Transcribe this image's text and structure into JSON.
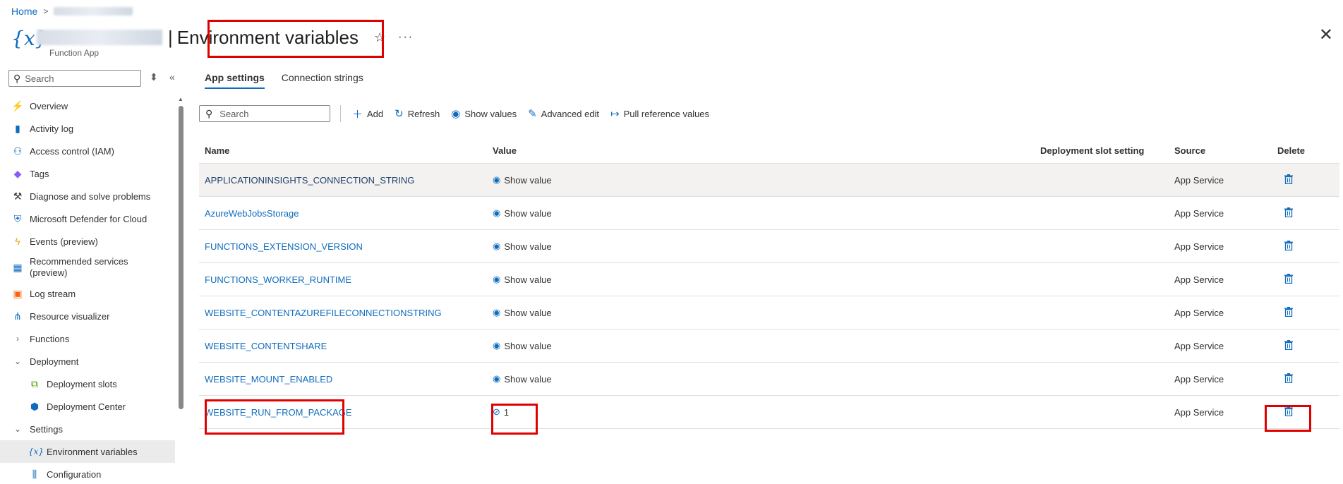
{
  "breadcrumb": {
    "home": "Home",
    "separator": ">"
  },
  "header": {
    "title": "Environment variables",
    "pipe": "|",
    "subtitle": "Function App",
    "resource_icon": "function-variable-icon",
    "favorite_icon": "star-icon",
    "more_label": "···",
    "close_label": "✕"
  },
  "sidebar": {
    "search_placeholder": "Search",
    "items": [
      {
        "label": "Overview",
        "icon": "lightning-overview-icon",
        "glyph": "⚡",
        "color": "#8a5cf6"
      },
      {
        "label": "Activity log",
        "icon": "book-icon",
        "glyph": "▮",
        "color": "#0f6cbd"
      },
      {
        "label": "Access control (IAM)",
        "icon": "people-icon",
        "glyph": "⚇",
        "color": "#0f6cbd"
      },
      {
        "label": "Tags",
        "icon": "tag-icon",
        "glyph": "◆",
        "color": "#8a5cf6"
      },
      {
        "label": "Diagnose and solve problems",
        "icon": "wrench-icon",
        "glyph": "⚒",
        "color": "#323130"
      },
      {
        "label": "Microsoft Defender for Cloud",
        "icon": "shield-icon",
        "glyph": "⛨",
        "color": "#0f6cbd"
      },
      {
        "label": "Events (preview)",
        "icon": "bolt-icon",
        "glyph": "ϟ",
        "color": "#e8a317"
      },
      {
        "label": "Recommended services (preview)",
        "icon": "grid-icon",
        "glyph": "▦",
        "color": "#0f6cbd"
      },
      {
        "label": "Log stream",
        "icon": "log-stream-icon",
        "glyph": "▣",
        "color": "#f7630c"
      },
      {
        "label": "Resource visualizer",
        "icon": "hierarchy-icon",
        "glyph": "⋔",
        "color": "#0f6cbd"
      },
      {
        "label": "Functions",
        "icon": "chevron-right-icon",
        "glyph": "›",
        "color": "#605e5c"
      },
      {
        "label": "Deployment",
        "icon": "chevron-down-icon",
        "glyph": "⌄",
        "color": "#605e5c"
      },
      {
        "label": "Deployment slots",
        "icon": "slots-icon",
        "glyph": "⧉",
        "color": "#57a300"
      },
      {
        "label": "Deployment Center",
        "icon": "cube-icon",
        "glyph": "⬢",
        "color": "#0f6cbd"
      },
      {
        "label": "Settings",
        "icon": "chevron-down-icon",
        "glyph": "⌄",
        "color": "#605e5c"
      },
      {
        "label": "Environment variables",
        "icon": "variable-icon",
        "glyph": "{x}",
        "color": "#0f6cbd"
      },
      {
        "label": "Configuration",
        "icon": "sliders-icon",
        "glyph": "⫼",
        "color": "#0f6cbd"
      }
    ]
  },
  "tabs": [
    {
      "label": "App settings",
      "active": true
    },
    {
      "label": "Connection strings",
      "active": false
    }
  ],
  "toolbar": {
    "search_placeholder": "Search",
    "add": "Add",
    "refresh": "Refresh",
    "show_values": "Show values",
    "advanced_edit": "Advanced edit",
    "pull_reference": "Pull reference values"
  },
  "table": {
    "columns": {
      "name": "Name",
      "value": "Value",
      "slot": "Deployment slot setting",
      "source": "Source",
      "delete": "Delete"
    },
    "rows": [
      {
        "name": "APPLICATIONINSIGHTS_CONNECTION_STRING",
        "value": "Show value",
        "source": "App Service"
      },
      {
        "name": "AzureWebJobsStorage",
        "value": "Show value",
        "source": "App Service"
      },
      {
        "name": "FUNCTIONS_EXTENSION_VERSION",
        "value": "Show value",
        "source": "App Service"
      },
      {
        "name": "FUNCTIONS_WORKER_RUNTIME",
        "value": "Show value",
        "source": "App Service"
      },
      {
        "name": "WEBSITE_CONTENTAZUREFILECONNECTIONSTRING",
        "value": "Show value",
        "source": "App Service"
      },
      {
        "name": "WEBSITE_CONTENTSHARE",
        "value": "Show value",
        "source": "App Service"
      },
      {
        "name": "WEBSITE_MOUNT_ENABLED",
        "value": "Show value",
        "source": "App Service"
      },
      {
        "name": "WEBSITE_RUN_FROM_PACKAGE",
        "value": "1",
        "source": "App Service"
      }
    ]
  },
  "colors": {
    "accent": "#0f6cbd",
    "highlight": "#e00000",
    "active_nav": "#ebebeb"
  }
}
